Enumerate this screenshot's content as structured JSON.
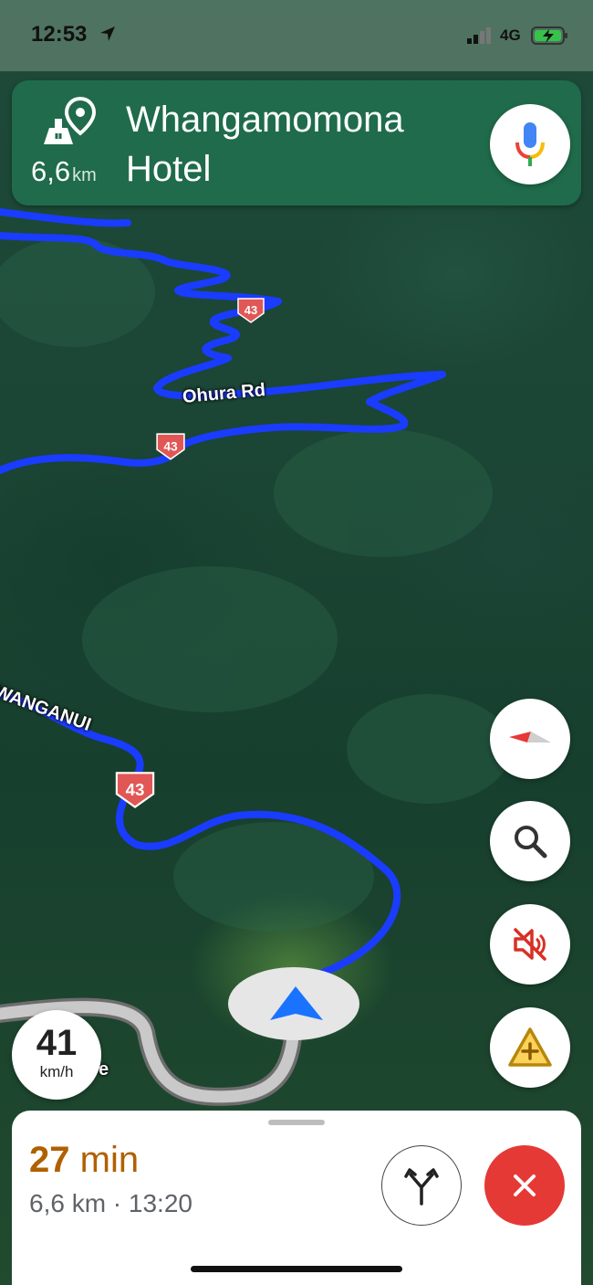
{
  "status_bar": {
    "time": "12:53",
    "network": "4G"
  },
  "navigation": {
    "distance_value": "6,6",
    "distance_unit": "km",
    "destination": "Whangamomona Hotel"
  },
  "map": {
    "road_labels": {
      "ohura": "Ohura Rd",
      "wanganui": "-WANGANUI",
      "bottom_fragment": "e"
    },
    "shield_number": "43"
  },
  "speed": {
    "value": "41",
    "unit": "km/h"
  },
  "trip": {
    "minutes": "27",
    "minutes_unit": "min",
    "summary": "6,6 km · 13:20"
  },
  "colors": {
    "route": "#1a3cff",
    "banner": "#1f6b4b",
    "eta": "#b06000",
    "close": "#e53935"
  }
}
